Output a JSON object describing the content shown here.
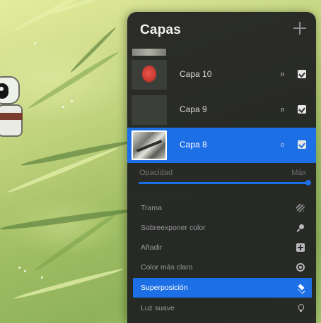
{
  "panel": {
    "title": "Capas",
    "add_icon": "plus-icon"
  },
  "layers": [
    {
      "name": "Capa 10",
      "blend_mode_label": "o",
      "visible": true,
      "selected": false,
      "thumbnail": "red-blob"
    },
    {
      "name": "Capa 9",
      "blend_mode_label": "o",
      "visible": true,
      "selected": false,
      "thumbnail": "empty"
    },
    {
      "name": "Capa 8",
      "blend_mode_label": "o",
      "visible": true,
      "selected": true,
      "thumbnail": "sketch"
    }
  ],
  "opacity": {
    "label": "Opacidad",
    "max_label": "Máx",
    "value": 1.0
  },
  "blend_modes": [
    {
      "label": "Trama",
      "icon": "hatch-icon",
      "selected": false
    },
    {
      "label": "Sobreexponer color",
      "icon": "pin-icon",
      "selected": false
    },
    {
      "label": "Añadir",
      "icon": "plus-square-icon",
      "selected": false
    },
    {
      "label": "Color más claro",
      "icon": "sun-icon",
      "selected": false
    },
    {
      "label": "Superposición",
      "icon": "layers-icon",
      "selected": true
    },
    {
      "label": "Luz suave",
      "icon": "bulb-icon",
      "selected": false
    }
  ],
  "colors": {
    "accent": "#1d6fe6",
    "panel_bg": "#1e1e20",
    "canvas_green": "#a6c46c"
  }
}
